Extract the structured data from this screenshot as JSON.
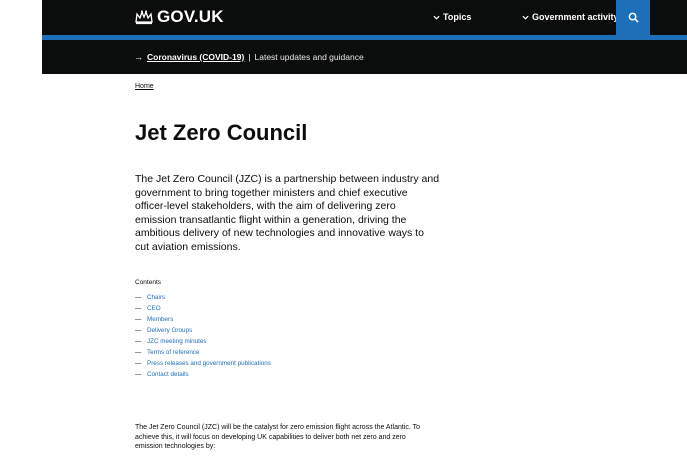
{
  "header": {
    "logo_text": "GOV.UK",
    "nav_topics": "Topics",
    "nav_government_activity": "Government activity"
  },
  "banner": {
    "arrow": "→",
    "link": "Coronavirus (COVID-19)",
    "separator": "|",
    "text": "Latest updates and guidance"
  },
  "breadcrumb": {
    "home": "Home"
  },
  "page": {
    "title": "Jet Zero Council",
    "lead": "The Jet Zero Council (JZC) is a partnership between industry and government to bring together ministers and chief executive officer-level stakeholders, with the aim of delivering zero emission transatlantic flight within a generation, driving the ambitious delivery of new technologies and innovative ways to cut aviation emissions.",
    "body": "The Jet Zero Council (JZC) will be the catalyst for zero emission flight across the Atlantic. To achieve this, it will focus on developing UK capabilities to deliver both net zero and zero emission technologies by:"
  },
  "contents": {
    "heading": "Contents",
    "dash": "—",
    "items": [
      "Chairs",
      "CEO",
      "Members",
      "Delivery Groups",
      "JZC meeting minutes",
      "Terms of reference",
      "Press releases and government publications",
      "Contact details"
    ]
  },
  "colors": {
    "header_bg": "#0b0c0c",
    "brand_blue": "#1d70b8",
    "link": "#1d70b8",
    "text": "#0b0c0c"
  },
  "icons": {
    "logo": "crown-icon",
    "nav_chevron": "chevron-down-icon",
    "search": "search-icon"
  }
}
